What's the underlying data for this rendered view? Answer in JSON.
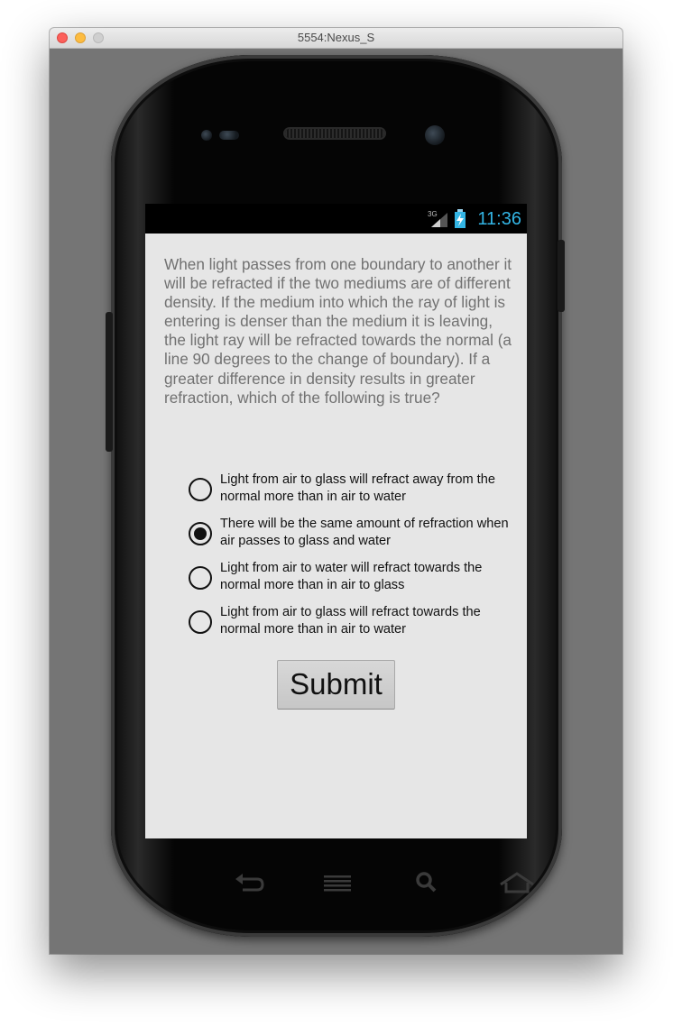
{
  "window": {
    "title": "5554:Nexus_S"
  },
  "status_bar": {
    "network": "3G",
    "time": "11:36",
    "accent_color": "#33b5e5"
  },
  "question": {
    "text": "When light passes from one boundary to another it will be refracted if the two mediums are of different density. If the medium into which the ray of light is entering is denser than the medium it is leaving, the light ray will be refracted towards the normal (a line 90 degrees to the change of boundary). If a greater difference in density results in greater refraction, which of the following is true?"
  },
  "options": [
    {
      "label": "Light from air to glass will refract away from the normal more than in air to water",
      "selected": false
    },
    {
      "label": "There will be the same amount of refraction when air passes to glass and water",
      "selected": true
    },
    {
      "label": "Light from air to water will refract towards the normal more than in air to glass",
      "selected": false
    },
    {
      "label": "Light from air to glass will refract towards the normal more than in air to water",
      "selected": false
    }
  ],
  "submit_label": "Submit",
  "nav_keys": [
    "back-icon",
    "menu-icon",
    "search-icon",
    "home-icon"
  ]
}
